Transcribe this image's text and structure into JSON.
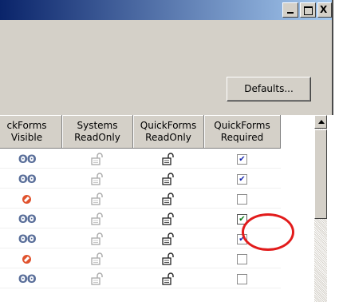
{
  "window": {
    "caption_buttons": {
      "minimize": "_",
      "maximize": "□",
      "close": "X"
    }
  },
  "defaults_button": {
    "label": "Defaults..."
  },
  "grid": {
    "columns": [
      {
        "line1": "ckForms",
        "line2": "Visible"
      },
      {
        "line1": "Systems",
        "line2": "ReadOnly"
      },
      {
        "line1": "QuickForms",
        "line2": "ReadOnly"
      },
      {
        "line1": "QuickForms",
        "line2": "Required"
      }
    ],
    "rows": [
      {
        "visible": "glasses",
        "systems_readonly": "unlocked",
        "quickforms_readonly": "unlocked",
        "required": true
      },
      {
        "visible": "glasses",
        "systems_readonly": "unlocked",
        "quickforms_readonly": "unlocked",
        "required": true
      },
      {
        "visible": "no",
        "systems_readonly": "unlocked",
        "quickforms_readonly": "unlocked",
        "required": false
      },
      {
        "visible": "glasses",
        "systems_readonly": "unlocked",
        "quickforms_readonly": "unlocked",
        "required": true,
        "highlighted": true
      },
      {
        "visible": "glasses",
        "systems_readonly": "unlocked",
        "quickforms_readonly": "unlocked",
        "required": true
      },
      {
        "visible": "no",
        "systems_readonly": "unlocked",
        "quickforms_readonly": "unlocked",
        "required": false
      },
      {
        "visible": "glasses",
        "systems_readonly": "unlocked",
        "quickforms_readonly": "unlocked",
        "required": false
      }
    ]
  },
  "icons": {
    "visible": "glasses-icon",
    "hidden": "no-entry-icon",
    "readonly": "padlock-open-icon"
  },
  "colors": {
    "annotation_circle": "#e21b1b",
    "title_gradient_start": "#0a246a",
    "title_gradient_end": "#a6caf0"
  }
}
